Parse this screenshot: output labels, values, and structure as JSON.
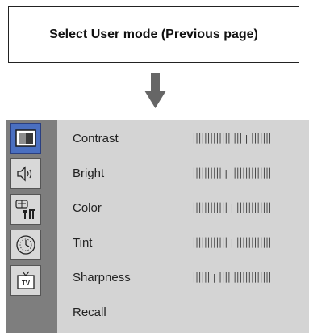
{
  "header": {
    "title": "Select User mode (Previous page)"
  },
  "menu": {
    "items": [
      {
        "label": "Contrast",
        "level": 0.7
      },
      {
        "label": "Bright",
        "level": 0.4
      },
      {
        "label": "Color",
        "level": 0.48
      },
      {
        "label": "Tint",
        "level": 0.5
      },
      {
        "label": "Sharpness",
        "level": 0.25
      },
      {
        "label": "Recall"
      }
    ]
  },
  "sidebar": {
    "icons": [
      "picture-icon",
      "sound-icon",
      "setup-tools-icon",
      "timer-clock-icon",
      "tv-input-icon"
    ]
  },
  "colors": {
    "menu_background": "#d4d4d4",
    "sidebar_background": "#7e7e7e",
    "active_icon": "#4a6fc0",
    "arrow": "#666666"
  }
}
